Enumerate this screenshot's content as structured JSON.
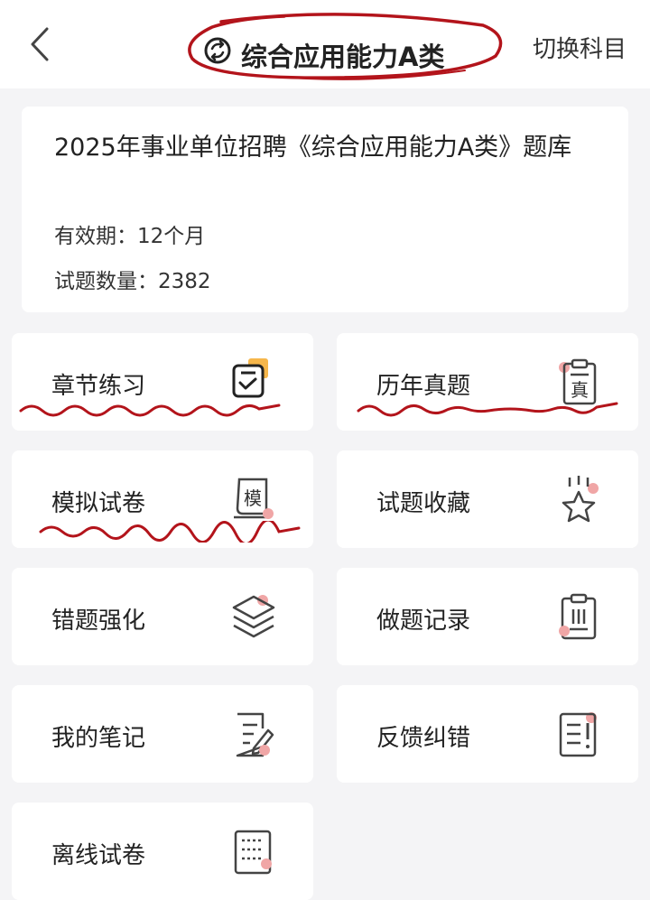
{
  "header": {
    "title": "综合应用能力A类",
    "switch_label": "切换科目"
  },
  "bank": {
    "title": "2025年事业单位招聘《综合应用能力A类》题库",
    "validity_label": "有效期：",
    "validity_value": "12个月",
    "count_label": "试题数量：",
    "count_value": "2382"
  },
  "menu": [
    {
      "label": "章节练习",
      "icon": "checklist-icon"
    },
    {
      "label": "历年真题",
      "icon": "clipboard-zhen-icon"
    },
    {
      "label": "模拟试卷",
      "icon": "scroll-mo-icon"
    },
    {
      "label": "试题收藏",
      "icon": "star-icon"
    },
    {
      "label": "错题强化",
      "icon": "layers-icon"
    },
    {
      "label": "做题记录",
      "icon": "clipboard-list-icon"
    },
    {
      "label": "我的笔记",
      "icon": "note-edit-icon"
    },
    {
      "label": "反馈纠错",
      "icon": "feedback-icon"
    },
    {
      "label": "离线试卷",
      "icon": "offline-paper-icon"
    }
  ],
  "colors": {
    "accent_dot": "#f0a6a6",
    "annotation_red": "#b3141b",
    "badge_orange": "#f6b64a"
  }
}
